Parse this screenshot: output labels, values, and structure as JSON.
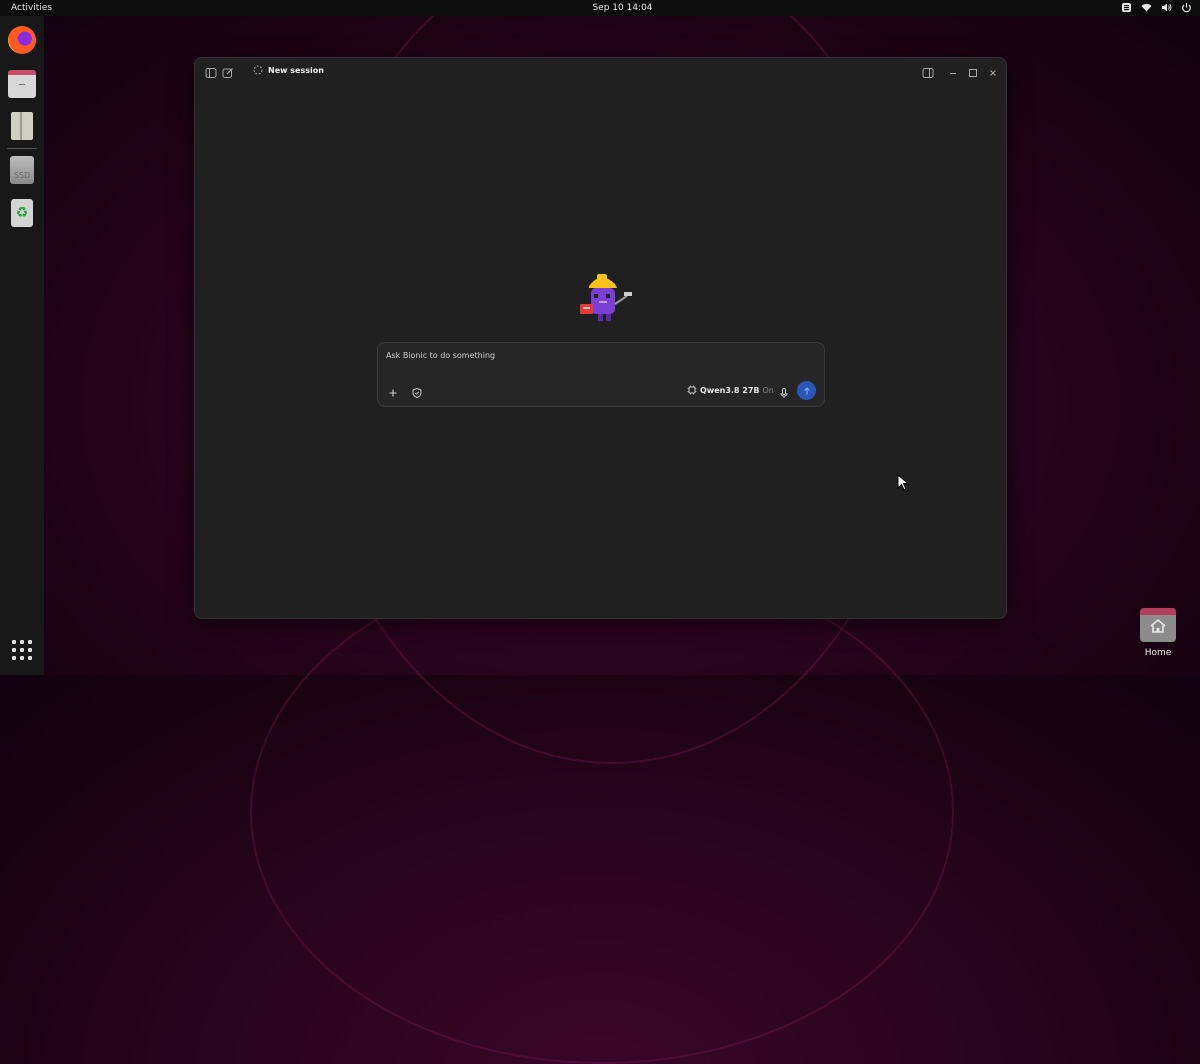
{
  "topbar": {
    "activities": "Activities",
    "datetime": "Sep 10  14:04",
    "tray_icons": [
      "keyboard-layout-icon",
      "wifi-icon",
      "volume-icon",
      "power-icon"
    ]
  },
  "dock": {
    "items": [
      "firefox-icon",
      "files-icon",
      "archive-icon",
      "ssd-drive-icon",
      "trash-icon"
    ],
    "ssd_label": "SSD",
    "apps_button": "apps-grid-icon"
  },
  "desktop": {
    "home_label": "Home"
  },
  "window": {
    "session_title": "New session",
    "composer": {
      "placeholder": "Ask Bionic to do something",
      "model_name": "Qwen3.8 27B",
      "model_status": "On"
    }
  },
  "colors": {
    "accent": "#2b56b8",
    "window_bg": "#202020",
    "desktop_bg": "#2a041d"
  }
}
